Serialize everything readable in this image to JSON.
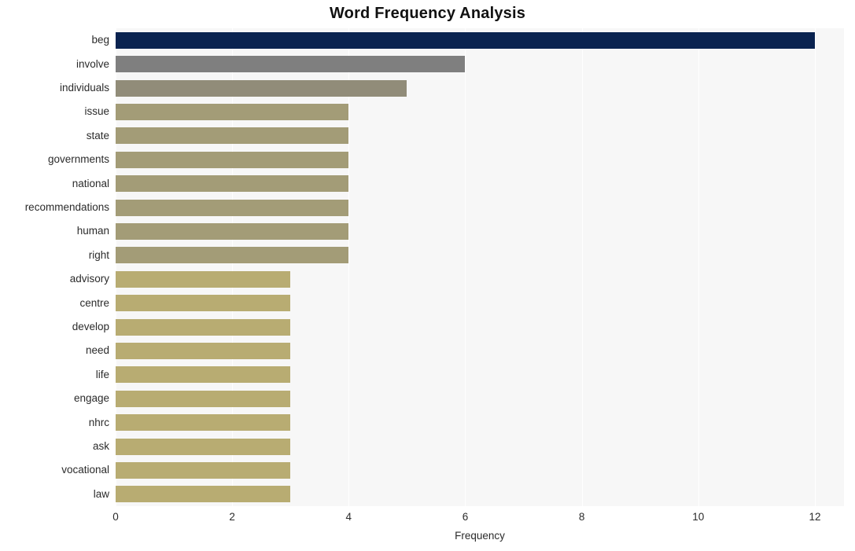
{
  "chart_data": {
    "type": "bar",
    "orientation": "horizontal",
    "title": "Word Frequency Analysis",
    "xlabel": "Frequency",
    "ylabel": "",
    "categories": [
      "beg",
      "involve",
      "individuals",
      "issue",
      "state",
      "governments",
      "national",
      "recommendations",
      "human",
      "right",
      "advisory",
      "centre",
      "develop",
      "need",
      "life",
      "engage",
      "nhrc",
      "ask",
      "vocational",
      "law"
    ],
    "values": [
      12,
      6,
      5,
      4,
      4,
      4,
      4,
      4,
      4,
      4,
      3,
      3,
      3,
      3,
      3,
      3,
      3,
      3,
      3,
      3
    ],
    "bar_colors": [
      "#0a2350",
      "#7f7f7f",
      "#918c79",
      "#a39c77",
      "#a39c77",
      "#a39c77",
      "#a39c77",
      "#a39c77",
      "#a39c77",
      "#a39c77",
      "#b8ac72",
      "#b8ac72",
      "#b8ac72",
      "#b8ac72",
      "#b8ac72",
      "#b8ac72",
      "#b8ac72",
      "#b8ac72",
      "#b8ac72",
      "#b8ac72"
    ],
    "xlim": [
      0,
      12.5
    ],
    "xticks": [
      0,
      2,
      4,
      6,
      8,
      10,
      12
    ],
    "xtick_labels": [
      "0",
      "2",
      "4",
      "6",
      "8",
      "10",
      "12"
    ],
    "grid": true,
    "grid_axis": "x",
    "legend": null,
    "plot_background": "#f7f7f7",
    "figure_background": "#ffffff",
    "gridline_color": "#ffffff",
    "text_color": "#2b2b2b",
    "title_color": "#111111"
  }
}
